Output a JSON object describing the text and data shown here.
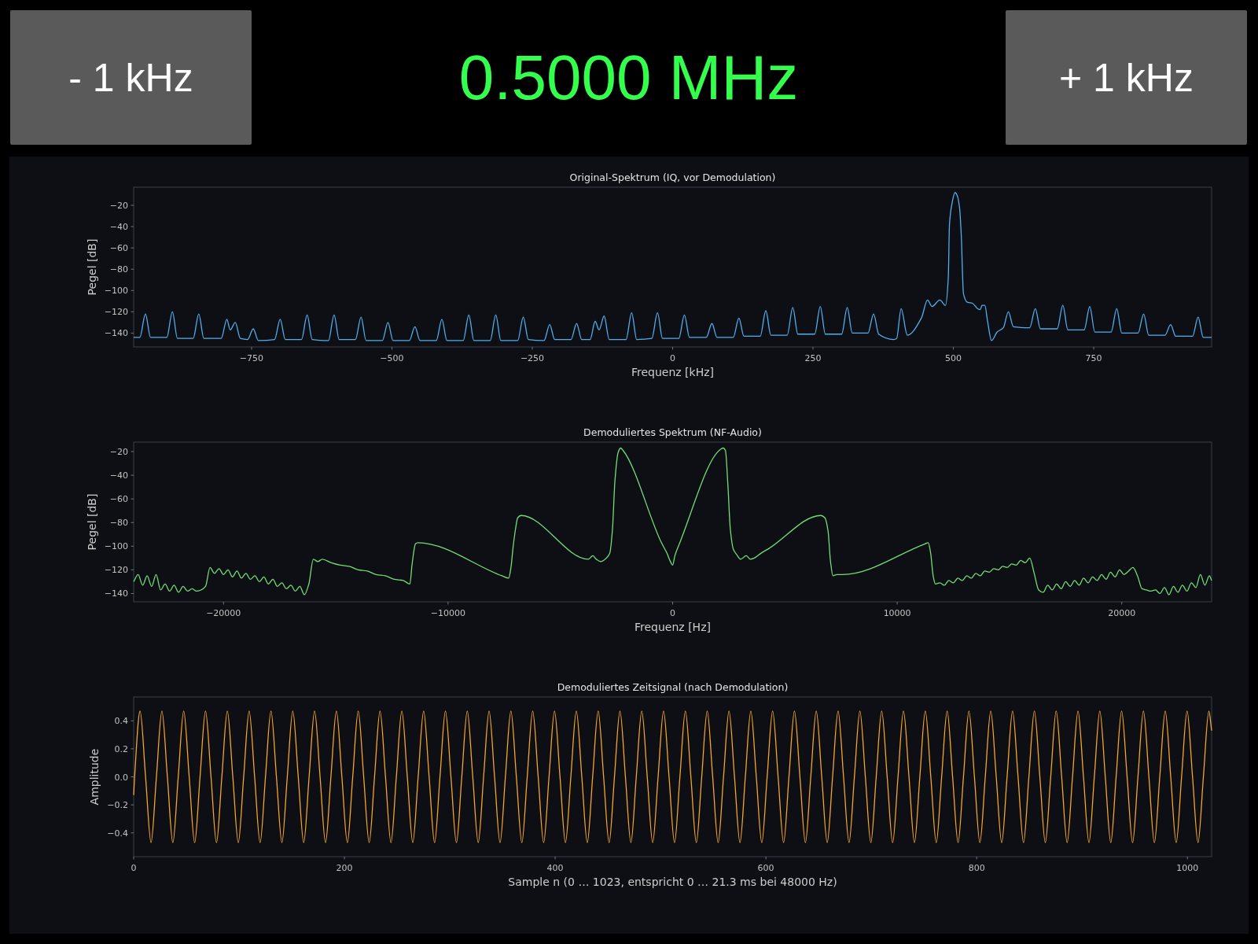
{
  "top_bar": {
    "minus_button": "- 1 kHz",
    "frequency_display": "0.5000 MHz",
    "plus_button": "+ 1 kHz"
  },
  "plots": [
    {
      "chart_data": {
        "type": "line",
        "title": "Original-Spektrum (IQ, vor Demodulation)",
        "xlabel": "Frequenz [kHz]",
        "ylabel": "Pegel [dB]",
        "xlim": [
          -960,
          960
        ],
        "ylim": [
          -153,
          -3
        ],
        "xticks": [
          {
            "value": -750,
            "label": "−750"
          },
          {
            "value": -500,
            "label": "−500"
          },
          {
            "value": -250,
            "label": "−250"
          },
          0,
          250,
          500,
          750
        ],
        "yticks": [
          {
            "value": -140,
            "label": "−140"
          },
          {
            "value": -120,
            "label": "−120"
          },
          {
            "value": -100,
            "label": "−100"
          },
          {
            "value": -80,
            "label": "−80"
          },
          {
            "value": -60,
            "label": "−60"
          },
          {
            "value": -40,
            "label": "−40"
          },
          {
            "value": -20,
            "label": "−20"
          }
        ],
        "x": [
          -960,
          -949,
          -939,
          -930,
          -901,
          -891,
          -882,
          -854,
          -844,
          -835,
          -804,
          -794,
          -788,
          -779,
          -770,
          -757,
          -747,
          -738,
          -709,
          -699,
          -690,
          -661,
          -651,
          -642,
          -613,
          -603,
          -594,
          -565,
          -555,
          -546,
          -517,
          -507,
          -498,
          -469,
          -459,
          -450,
          -421,
          -411,
          -402,
          -373,
          -363,
          -354,
          -325,
          -315,
          -306,
          -276,
          -266,
          -257,
          -229,
          -219,
          -210,
          -181,
          -171,
          -162,
          -147,
          -138,
          -131,
          -122,
          -113,
          -83,
          -73,
          -64,
          -37,
          -27,
          -18,
          11,
          21,
          30,
          60,
          70,
          79,
          108,
          118,
          127,
          156,
          166,
          175,
          204,
          214,
          223,
          253,
          263,
          272,
          301,
          311,
          320,
          348,
          358,
          367,
          394,
          399,
          407,
          418,
          443,
          454,
          462,
          476,
          486,
          491,
          493,
          497,
          503,
          507,
          511,
          514,
          518,
          525,
          534,
          543,
          548,
          551,
          556,
          561,
          568,
          578,
          589,
          598,
          607,
          636,
          646,
          655,
          685,
          695,
          704,
          733,
          743,
          752,
          781,
          791,
          800,
          829,
          839,
          848,
          877,
          887,
          896,
          926,
          936,
          945,
          960
        ],
        "series": [
          {
            "color": "#4fb0ee",
            "values": [
              -144,
              -144,
              -122,
              -144,
              -144,
              -120,
              -145,
              -145,
              -122,
              -145,
              -145,
              -127,
              -137,
              -130,
              -145,
              -146,
              -136,
              -147,
              -146,
              -127,
              -146,
              -146,
              -123,
              -146,
              -147,
              -123,
              -146,
              -146,
              -125,
              -147,
              -147,
              -130,
              -147,
              -147,
              -134,
              -147,
              -147,
              -127,
              -147,
              -147,
              -123,
              -147,
              -147,
              -123,
              -147,
              -147,
              -125,
              -146,
              -147,
              -132,
              -146,
              -146,
              -131,
              -146,
              -146,
              -129,
              -137,
              -124,
              -146,
              -146,
              -121,
              -146,
              -145,
              -121,
              -145,
              -145,
              -123,
              -144,
              -144,
              -131,
              -144,
              -144,
              -126,
              -143,
              -143,
              -119,
              -142,
              -142,
              -116,
              -141,
              -141,
              -115,
              -141,
              -141,
              -116,
              -140,
              -140,
              -122,
              -141,
              -146,
              -145,
              -117,
              -142,
              -126,
              -109,
              -115,
              -109,
              -114,
              -88,
              -39,
              -20,
              -8,
              -11,
              -22,
              -47,
              -103,
              -111,
              -112,
              -117,
              -118,
              -114,
              -114,
              -129,
              -147,
              -139,
              -135,
              -120,
              -134,
              -135,
              -117,
              -136,
              -136,
              -114,
              -137,
              -137,
              -115,
              -139,
              -139,
              -117,
              -140,
              -140,
              -122,
              -142,
              -142,
              -132,
              -143,
              -143,
              -125,
              -144,
              -144
            ]
          }
        ]
      }
    },
    {
      "chart_data": {
        "type": "line",
        "title": "Demoduliertes Spektrum (NF-Audio)",
        "xlabel": "Frequenz [Hz]",
        "ylabel": "Pegel [dB]",
        "xlim": [
          -24000,
          24000
        ],
        "ylim": [
          -147,
          -12
        ],
        "xticks": [
          {
            "value": -20000,
            "label": "−20000"
          },
          {
            "value": -10000,
            "label": "−10000"
          },
          0,
          10000,
          20000
        ],
        "yticks": [
          {
            "value": -140,
            "label": "−140"
          },
          {
            "value": -120,
            "label": "−120"
          },
          {
            "value": -100,
            "label": "−100"
          },
          {
            "value": -80,
            "label": "−80"
          },
          {
            "value": -60,
            "label": "−60"
          },
          {
            "value": -40,
            "label": "−40"
          },
          {
            "value": -20,
            "label": "−20"
          }
        ],
        "x": [
          -24000,
          -23800,
          -23600,
          -23400,
          -23200,
          -23000,
          -22800,
          -22600,
          -22400,
          -22200,
          -22000,
          -21800,
          -21600,
          -21400,
          -21200,
          -21000,
          -20800,
          -20600,
          -20400,
          -20200,
          -20000,
          -19800,
          -19600,
          -19400,
          -19200,
          -19000,
          -18800,
          -18600,
          -18400,
          -18200,
          -18000,
          -17800,
          -17600,
          -17400,
          -17200,
          -17000,
          -16800,
          -16600,
          -16400,
          -16200,
          -16000,
          -15800,
          -15600,
          -15200,
          -14800,
          -14400,
          -14000,
          -13600,
          -13200,
          -12800,
          -12400,
          -12000,
          -11700,
          -11600,
          -11450,
          -11350,
          -7600,
          -7300,
          -7200,
          -7100,
          -7000,
          -6900,
          -6750,
          -3750,
          -3550,
          -3400,
          -3200,
          -2950,
          -2800,
          -2680,
          -2570,
          -2430,
          -2320,
          -2210,
          -500,
          -250,
          -100,
          0,
          100,
          300,
          2140,
          2250,
          2350,
          2460,
          2570,
          2710,
          2850,
          3030,
          3280,
          3460,
          3640,
          3930,
          4280,
          6600,
          6780,
          6920,
          7030,
          7140,
          7310,
          7560,
          11240,
          11380,
          11490,
          11600,
          11700,
          11900,
          12100,
          12300,
          12500,
          12700,
          12900,
          13100,
          13300,
          13500,
          13700,
          13900,
          14100,
          14300,
          14500,
          14700,
          14900,
          15100,
          15300,
          15500,
          15700,
          15900,
          16100,
          16300,
          16500,
          16700,
          16900,
          17100,
          17300,
          17500,
          17700,
          17900,
          18100,
          18300,
          18500,
          18700,
          18900,
          19100,
          19300,
          19500,
          19700,
          19900,
          20100,
          20300,
          20500,
          20700,
          20900,
          21100,
          21300,
          21500,
          21700,
          21900,
          22100,
          22300,
          22500,
          22700,
          22900,
          23100,
          23300,
          23500,
          23700,
          23900,
          24000
        ],
        "series": [
          {
            "color": "#72de78",
            "values": [
              -130,
              -124,
              -133,
              -125,
              -134,
              -124,
              -137,
              -132,
              -138,
              -133,
              -139,
              -134,
              -138,
              -136,
              -138,
              -137,
              -134,
              -118,
              -123,
              -119,
              -124,
              -120,
              -126,
              -121,
              -127,
              -123,
              -128,
              -125,
              -130,
              -126,
              -132,
              -128,
              -134,
              -131,
              -136,
              -133,
              -138,
              -134,
              -141,
              -132,
              -111,
              -113,
              -111,
              -114,
              -116,
              -117,
              -120,
              -121,
              -124,
              -125,
              -128,
              -129,
              -132,
              -115,
              -98,
              -97,
              -125,
              -127,
              -118,
              -100,
              -86,
              -76,
              -74,
              -111,
              -108,
              -111,
              -113,
              -110,
              -106,
              -86,
              -45,
              -21,
              -17,
              -19,
              -97,
              -106,
              -113,
              -116,
              -108,
              -98,
              -18,
              -17,
              -19,
              -48,
              -86,
              -103,
              -107,
              -111,
              -108,
              -111,
              -110,
              -106,
              -102,
              -74,
              -76,
              -87,
              -113,
              -125,
              -124,
              -124,
              -98,
              -97,
              -106,
              -125,
              -132,
              -131,
              -133,
              -129,
              -131,
              -127,
              -129,
              -125,
              -127,
              -123,
              -125,
              -121,
              -122,
              -119,
              -120,
              -117,
              -118,
              -115,
              -116,
              -112,
              -114,
              -110,
              -123,
              -137,
              -139,
              -133,
              -137,
              -132,
              -136,
              -130,
              -134,
              -129,
              -133,
              -127,
              -131,
              -126,
              -129,
              -124,
              -128,
              -122,
              -126,
              -120,
              -124,
              -121,
              -118,
              -125,
              -136,
              -137,
              -138,
              -137,
              -140,
              -135,
              -141,
              -134,
              -139,
              -133,
              -138,
              -131,
              -135,
              -124,
              -133,
              -125,
              -129
            ]
          }
        ]
      }
    },
    {
      "chart_data": {
        "type": "line",
        "title": "Demoduliertes Zeitsignal (nach Demodulation)",
        "xlabel": "Sample n (0 … 1023, entspricht 0 … 21.3 ms bei 48000 Hz)",
        "ylabel": "Amplitude",
        "xlim": [
          0,
          1023
        ],
        "ylim": [
          -0.57,
          0.57
        ],
        "xticks": [
          0,
          200,
          400,
          600,
          800,
          1000
        ],
        "yticks": [
          {
            "value": -0.4,
            "label": "−0.4"
          },
          {
            "value": -0.2,
            "label": "−0.2"
          },
          {
            "value": 0,
            "label": "0.0"
          },
          0.2,
          0.4
        ],
        "x": [
          0,
          0.9,
          6.1,
          11.3,
          16.5,
          21.6,
          26.8,
          32.0,
          37.2,
          42.3,
          47.5,
          52.7,
          57.9,
          63.0,
          68.2,
          73.4,
          78.6,
          83.7,
          88.9,
          94.1,
          99.3,
          104.4,
          109.6,
          114.8,
          120.0,
          125.1,
          130.3,
          135.5,
          140.7,
          145.8,
          151.0,
          156.2,
          161.4,
          166.5,
          171.7,
          176.9,
          182.1,
          187.2,
          192.4,
          197.6,
          202.8,
          207.9,
          213.1,
          218.3,
          223.5,
          228.6,
          233.8,
          239.0,
          244.2,
          249.3,
          254.5,
          259.7,
          264.9,
          270.0,
          275.2,
          280.4,
          285.6,
          290.7,
          295.9,
          301.1,
          306.3,
          311.4,
          316.6,
          321.8,
          327.0,
          332.1,
          337.3,
          342.5,
          347.7,
          352.8,
          358.0,
          363.2,
          368.4,
          373.5,
          378.7,
          383.9,
          389.1,
          394.2,
          399.4,
          404.6,
          409.8,
          414.9,
          420.1,
          425.3,
          430.5,
          435.6,
          440.8,
          446.0,
          451.2,
          456.3,
          461.5,
          466.7,
          471.9,
          477.0,
          482.2,
          487.4,
          492.6,
          497.7,
          502.9,
          508.1,
          513.3,
          518.4,
          523.6,
          528.8,
          534.0,
          539.1,
          544.3,
          549.5,
          554.7,
          559.8,
          565.0,
          570.2,
          575.4,
          580.5,
          585.7,
          590.9,
          596.1,
          601.2,
          606.4,
          611.6,
          616.8,
          621.9,
          627.1,
          632.3,
          637.5,
          642.6,
          647.8,
          653.0,
          658.2,
          663.3,
          668.5,
          673.7,
          678.9,
          684.0,
          689.2,
          694.4,
          699.6,
          704.7,
          709.9,
          715.1,
          720.3,
          725.4,
          730.6,
          735.8,
          741.0,
          746.1,
          751.3,
          756.5,
          761.7,
          766.8,
          772.0,
          777.2,
          782.4,
          787.5,
          792.7,
          797.9,
          803.1,
          808.2,
          813.4,
          818.6,
          823.8,
          828.9,
          834.1,
          839.3,
          844.5,
          849.6,
          854.8,
          860.0,
          865.2,
          870.3,
          875.5,
          880.7,
          885.9,
          891.0,
          896.2,
          901.4,
          906.6,
          911.7,
          916.9,
          922.1,
          927.3,
          932.4,
          937.6,
          942.8,
          948.0,
          953.1,
          958.3,
          963.5,
          968.7,
          973.8,
          979.0,
          984.2,
          989.4,
          994.5,
          999.7,
          1004.9,
          1010.1,
          1015.2,
          1020.4,
          1023
        ],
        "series": [
          {
            "color": "#f5a62c",
            "values": [
              -0.13,
              0,
              0.47,
              0,
              -0.47,
              0,
              0.47,
              0,
              -0.47,
              0,
              0.47,
              0,
              -0.47,
              0,
              0.47,
              0,
              -0.47,
              0,
              0.47,
              0,
              -0.47,
              0,
              0.47,
              0,
              -0.47,
              0,
              0.47,
              0,
              -0.47,
              0,
              0.47,
              0,
              -0.47,
              0,
              0.47,
              0,
              -0.47,
              0,
              0.47,
              0,
              -0.47,
              0,
              0.47,
              0,
              -0.47,
              0,
              0.47,
              0,
              -0.47,
              0,
              0.47,
              0,
              -0.47,
              0,
              0.47,
              0,
              -0.47,
              0,
              0.47,
              0,
              -0.47,
              0,
              0.47,
              0,
              -0.47,
              0,
              0.47,
              0,
              -0.47,
              0,
              0.47,
              0,
              -0.47,
              0,
              0.47,
              0,
              -0.47,
              0,
              0.47,
              0,
              -0.47,
              0,
              0.47,
              0,
              -0.47,
              0,
              0.47,
              0,
              -0.47,
              0,
              0.47,
              0,
              -0.47,
              0,
              0.47,
              0,
              -0.47,
              0,
              0.47,
              0,
              -0.47,
              0,
              0.47,
              0,
              -0.47,
              0,
              0.47,
              0,
              -0.47,
              0,
              0.47,
              0,
              -0.47,
              0,
              0.47,
              0,
              -0.47,
              0,
              0.47,
              0,
              -0.47,
              0,
              0.47,
              0,
              -0.47,
              0,
              0.47,
              0,
              -0.47,
              0,
              0.47,
              0,
              -0.47,
              0,
              0.47,
              0,
              -0.47,
              0,
              0.47,
              0,
              -0.47,
              0,
              0.47,
              0,
              -0.47,
              0,
              0.47,
              0,
              -0.47,
              0,
              0.47,
              0,
              -0.47,
              0,
              0.47,
              0,
              -0.47,
              0,
              0.47,
              0,
              -0.47,
              0,
              0.47,
              0,
              -0.47,
              0,
              0.47,
              0,
              -0.47,
              0,
              0.47,
              0,
              -0.47,
              0,
              0.47,
              0,
              -0.47,
              0,
              0.47,
              0,
              -0.47,
              0,
              0.47,
              0,
              -0.47,
              0,
              0.47,
              0,
              -0.47,
              0,
              0.47,
              0,
              -0.47,
              0,
              0.47,
              0,
              -0.47,
              0,
              0.47,
              0.33
            ]
          }
        ]
      }
    }
  ]
}
